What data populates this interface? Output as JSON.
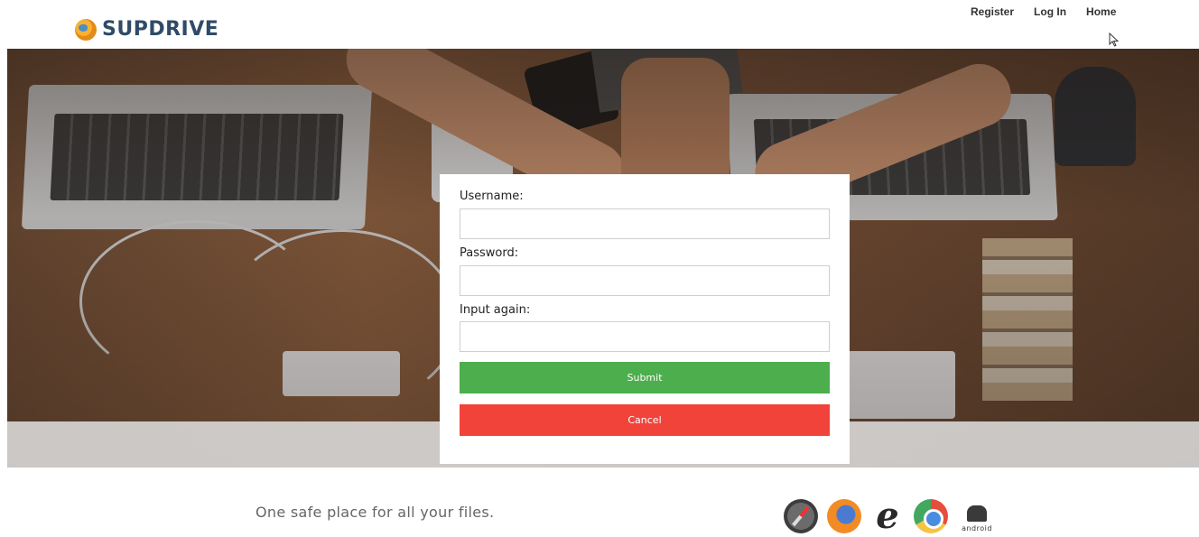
{
  "header": {
    "logo_text": "SUPDRIVE",
    "nav": [
      {
        "label": "Register"
      },
      {
        "label": "Log In"
      },
      {
        "label": "Home"
      }
    ]
  },
  "form": {
    "username_label": "Username:",
    "username_value": "",
    "password_label": "Password:",
    "password_value": "",
    "confirm_label": "Input again:",
    "confirm_value": "",
    "submit_label": "Submit",
    "cancel_label": "Cancel"
  },
  "footer": {
    "tagline": "One safe place for all your files.",
    "platforms": [
      "safari-icon",
      "firefox-icon",
      "internet-explorer-icon",
      "chrome-icon",
      "android-icon"
    ],
    "android_label": "android"
  },
  "colors": {
    "submit": "#4cae4c",
    "cancel": "#f2433b",
    "logo_text": "#2f4b67"
  }
}
